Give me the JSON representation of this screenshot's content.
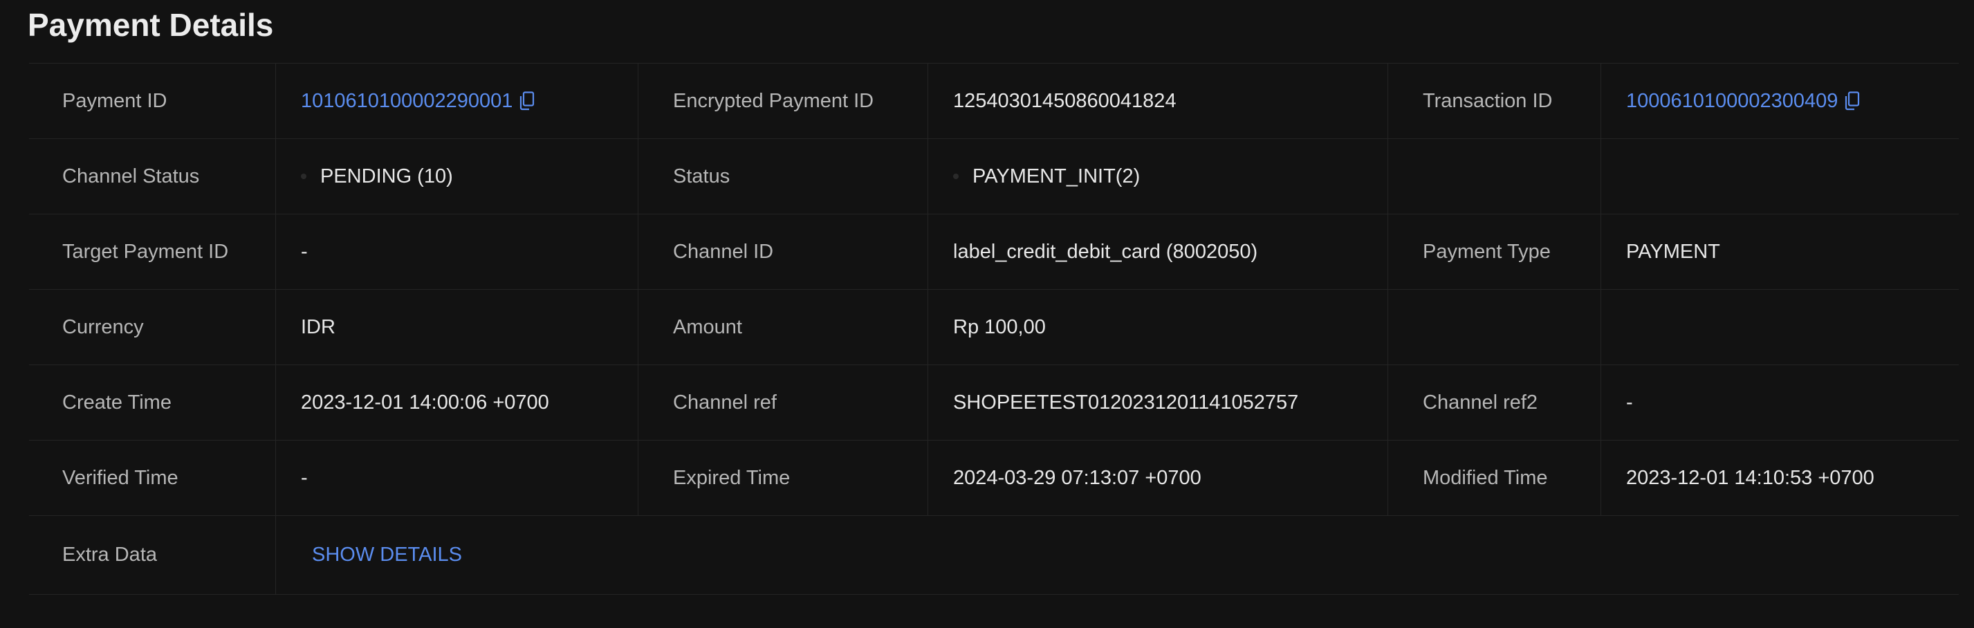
{
  "page_title": "Payment Details",
  "rows": [
    {
      "c1": {
        "label": "Payment ID",
        "value": "1010610100002290001"
      },
      "c2": {
        "label": "Encrypted Payment ID",
        "value": "12540301450860041824"
      },
      "c3": {
        "label": "Transaction ID",
        "value": "1000610100002300409"
      }
    },
    {
      "c1": {
        "label": "Channel Status",
        "value": "PENDING (10)"
      },
      "c2": {
        "label": "Status",
        "value": "PAYMENT_INIT(2)"
      },
      "c3": {
        "label": "",
        "value": ""
      }
    },
    {
      "c1": {
        "label": "Target Payment ID",
        "value": "-"
      },
      "c2": {
        "label": "Channel ID",
        "value": "label_credit_debit_card (8002050)"
      },
      "c3": {
        "label": "Payment Type",
        "value": "PAYMENT"
      }
    },
    {
      "c1": {
        "label": "Currency",
        "value": "IDR"
      },
      "c2": {
        "label": "Amount",
        "value": "Rp 100,00"
      },
      "c3": {
        "label": "",
        "value": ""
      }
    },
    {
      "c1": {
        "label": "Create Time",
        "value": "2023-12-01 14:00:06 +0700"
      },
      "c2": {
        "label": "Channel ref",
        "value": "SHOPEETEST0120231201141052757"
      },
      "c3": {
        "label": "Channel ref2",
        "value": "-"
      }
    },
    {
      "c1": {
        "label": "Verified Time",
        "value": "-"
      },
      "c2": {
        "label": "Expired Time",
        "value": "2024-03-29 07:13:07 +0700"
      },
      "c3": {
        "label": "Modified Time",
        "value": "2023-12-01 14:10:53 +0700"
      }
    }
  ],
  "extra": {
    "label": "Extra Data",
    "action_label": "SHOW DETAILS"
  },
  "icons": {
    "copy": "copy-icon",
    "status_dot": "status-dot-icon"
  },
  "colors": {
    "link": "#5b8def",
    "background": "#121212",
    "label": "#b7b7b7",
    "value": "#e8e8e8"
  }
}
